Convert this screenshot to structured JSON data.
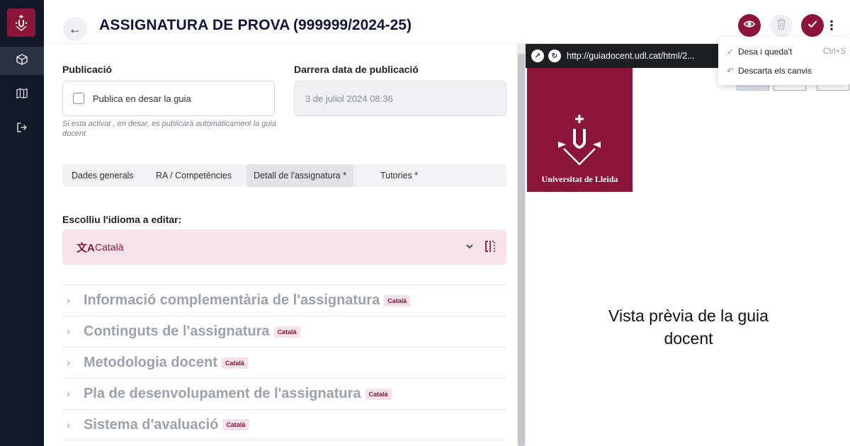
{
  "sidebar": {
    "items": [
      {
        "icon": "cube-icon"
      },
      {
        "icon": "map-icon"
      },
      {
        "icon": "logout-icon"
      }
    ]
  },
  "header": {
    "title": "ASSIGNATURA DE PROVA",
    "code": "(999999/2024-25)"
  },
  "publication": {
    "label": "Publicació",
    "checkbox_label": "Publica en desar la guia",
    "help": "Si esta activat , en desar, es publicarà automàticament la guia docent",
    "date_label": "Darrera data de publicació",
    "date_value": "3 de juliol 2024 08:36"
  },
  "tabs": [
    {
      "label": "Dades generals"
    },
    {
      "label": "RA / Competències"
    },
    {
      "label": "Detall de l'assignatura *"
    },
    {
      "label": "Tutories *"
    }
  ],
  "language": {
    "label": "Escolliu l'idioma a editar:",
    "value": "Català"
  },
  "sections": [
    {
      "title": "Informació complementària de l'assignatura",
      "badge": "Català"
    },
    {
      "title": "Continguts de l'assignatura",
      "badge": "Català"
    },
    {
      "title": "Metodologia docent",
      "badge": "Català"
    },
    {
      "title": "Pla de desenvolupament de l'assignatura",
      "badge": "Català"
    },
    {
      "title": "Sistema d'avaluació",
      "badge": "Català"
    }
  ],
  "preview": {
    "url": "http://guiadocent.udl.cat/html/2...",
    "logo_text": "Universitat de Lleida",
    "message": "Vista prèvia de la guia docent"
  },
  "menu": {
    "items": [
      {
        "label": "Desa i queda't",
        "shortcut": "Ctrl+S"
      },
      {
        "label": "Descarta els canvis",
        "shortcut": ""
      }
    ]
  },
  "colors": {
    "brand": "#8a1538",
    "sidebar": "#111827",
    "badge_bg": "#f9e1e9"
  }
}
